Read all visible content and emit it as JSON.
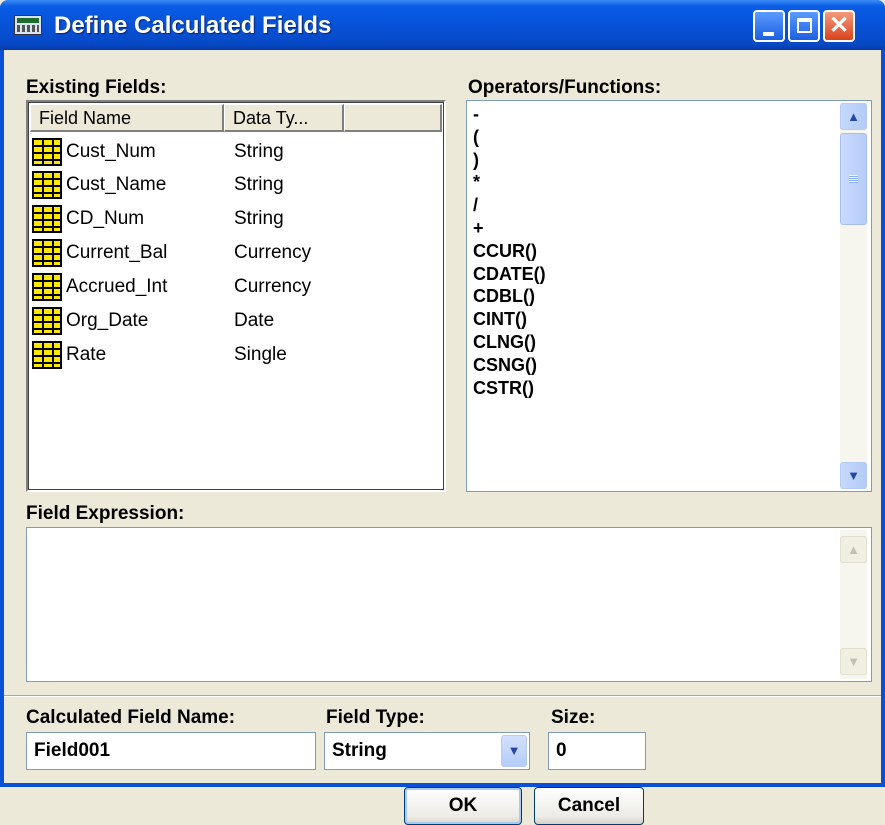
{
  "window": {
    "title": "Define Calculated Fields"
  },
  "existing_fields": {
    "label": "Existing Fields:",
    "columns": [
      "Field Name",
      "Data Ty..."
    ],
    "rows": [
      {
        "name": "Cust_Num",
        "type": "String"
      },
      {
        "name": "Cust_Name",
        "type": "String"
      },
      {
        "name": "CD_Num",
        "type": "String"
      },
      {
        "name": "Current_Bal",
        "type": "Currency"
      },
      {
        "name": "Accrued_Int",
        "type": "Currency"
      },
      {
        "name": "Org_Date",
        "type": "Date"
      },
      {
        "name": "Rate",
        "type": "Single"
      }
    ]
  },
  "operators": {
    "label": "Operators/Functions:",
    "items": [
      "-",
      "(",
      ")",
      "*",
      "/",
      "+",
      "CCUR()",
      "CDATE()",
      "CDBL()",
      "CINT()",
      "CLNG()",
      "CSNG()",
      "CSTR()"
    ]
  },
  "expression": {
    "label": "Field Expression:",
    "value": ""
  },
  "calc_name": {
    "label": "Calculated Field Name:",
    "value": "Field001"
  },
  "field_type": {
    "label": "Field Type:",
    "value": "String"
  },
  "size": {
    "label": "Size:",
    "value": "0"
  },
  "buttons": {
    "ok": "OK",
    "cancel": "Cancel"
  }
}
